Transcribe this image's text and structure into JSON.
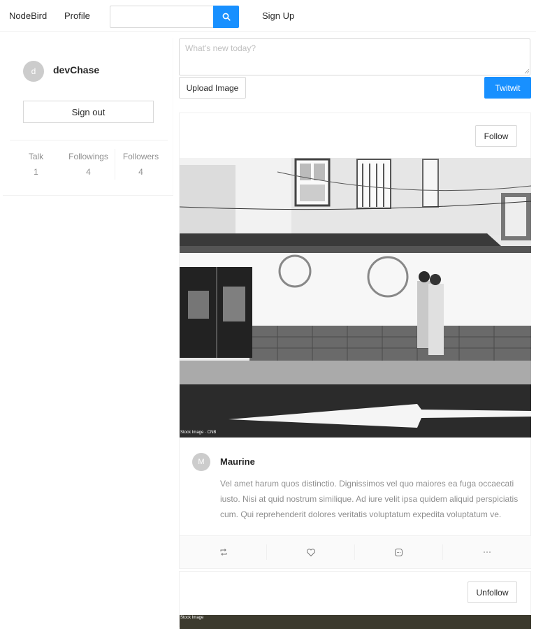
{
  "nav": {
    "brand": "NodeBird",
    "profile": "Profile",
    "signup": "Sign Up",
    "search_placeholder": ""
  },
  "user": {
    "avatar_initial": "d",
    "nickname": "devChase",
    "signout_label": "Sign out",
    "stats": [
      {
        "label": "Talk",
        "value": "1"
      },
      {
        "label": "Followings",
        "value": "4"
      },
      {
        "label": "Followers",
        "value": "4"
      }
    ]
  },
  "post_form": {
    "placeholder": "What's new today?",
    "upload_label": "Upload Image",
    "submit_label": "Twitwit"
  },
  "posts": [
    {
      "follow_label": "Follow",
      "image_caption": "Stock Image · CNB",
      "avatar_initial": "M",
      "author": "Maurine",
      "content": "Vel amet harum quos distinctio. Dignissimos vel quo maiores ea fuga occaecati iusto. Nisi at quid nostrum similique. Ad iure velit ipsa quidem aliquid perspiciatis cum. Qui reprehenderit dolores veritatis voluptatum expedita voluptatum ve.",
      "actions": [
        "retweet-icon",
        "heart-icon",
        "message-icon",
        "ellipsis-icon"
      ]
    },
    {
      "follow_label": "Unfollow",
      "image_caption": "Stock Image"
    }
  ],
  "colors": {
    "primary": "#1890ff",
    "border": "#f0f0f0",
    "avatar_bg": "#cccccc"
  }
}
